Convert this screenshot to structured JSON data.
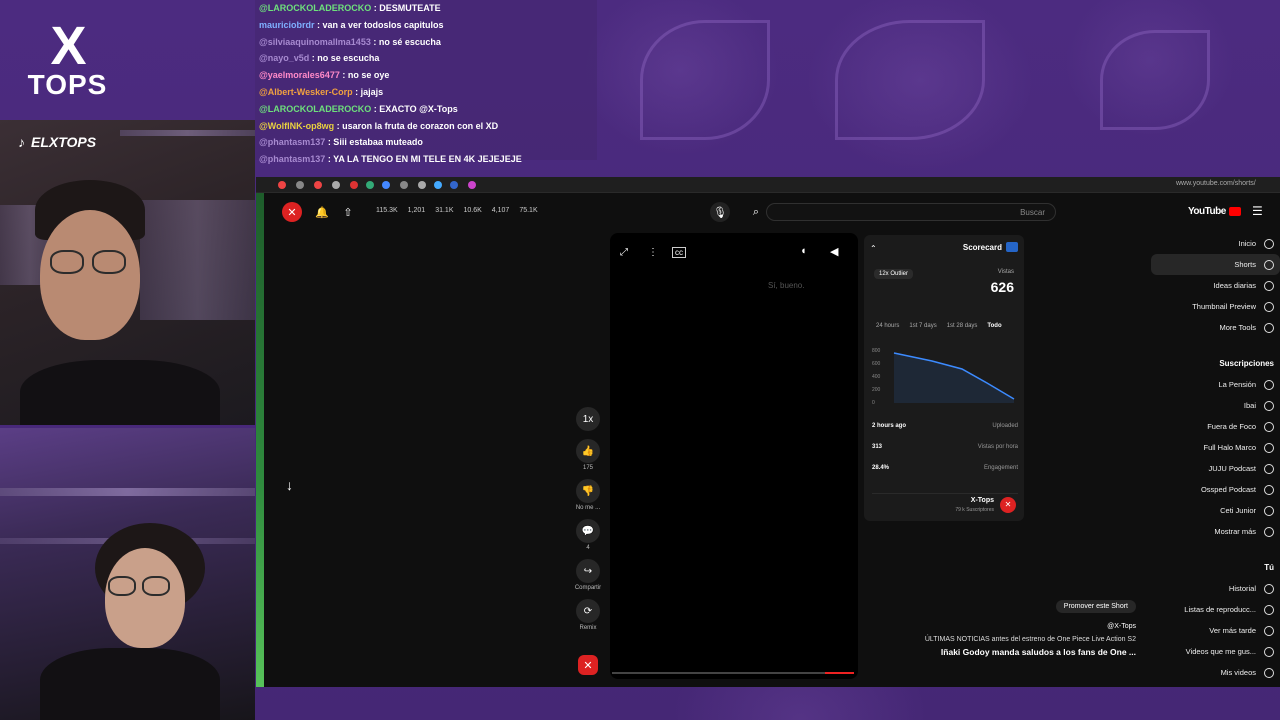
{
  "branding": {
    "logo_top": "X",
    "logo_bottom": "TOPS",
    "tiktok_handle": "ELXTOPS"
  },
  "chat": [
    {
      "user": "@LAROCKOLADEROCKO",
      "text": "DESMUTEATE",
      "color": "#6ee07c"
    },
    {
      "user": "mauriciobrdr",
      "text": "van a ver todoslos capitulos",
      "color": "#7fb0ff"
    },
    {
      "user": "@silviaaquinomallma1453",
      "text": "no sé escucha",
      "color": "#a78ad0"
    },
    {
      "user": "@nayo_v5d",
      "text": "no se escucha",
      "color": "#a78ad0"
    },
    {
      "user": "@yaelmorales6477",
      "text": "no se oye",
      "color": "#ff8ac8"
    },
    {
      "user": "@Albert-Wesker-Corp",
      "text": "jajajs",
      "color": "#f0a040"
    },
    {
      "user": "@LAROCKOLADEROCKO",
      "text": "EXACTO @X-Tops",
      "color": "#6ee07c"
    },
    {
      "user": "@WolfINK-op8wg",
      "text": "usaron la fruta de corazon con el XD",
      "color": "#e8d040"
    },
    {
      "user": "@phantasm137",
      "text": "Siii estabaa muteado",
      "color": "#a78ad0"
    },
    {
      "user": "@phantasm137",
      "text": "YA LA TENGO EN MI TELE EN 4K JEJEJEJE",
      "color": "#a78ad0"
    }
  ],
  "browser": {
    "url": "www.youtube.com/shorts/",
    "search_placeholder": "Buscar",
    "stats": [
      "115.3K",
      "1,201",
      "31.1K",
      "10.6K",
      "4,107",
      "75.1K"
    ]
  },
  "short": {
    "placeholder": "Sí, bueno.",
    "actions": [
      {
        "icon": "1x",
        "label": ""
      },
      {
        "icon": "👍",
        "label": "175"
      },
      {
        "icon": "👎",
        "label": "No me ..."
      },
      {
        "icon": "💬",
        "label": "4"
      },
      {
        "icon": "↪",
        "label": "Compartir"
      },
      {
        "icon": "⟳",
        "label": "Remix"
      }
    ],
    "progress": 0.12
  },
  "scorecard": {
    "title": "Scorecard",
    "badge": "12x Outlier",
    "views_label": "Vistas",
    "views": "626",
    "tabs": [
      "24 hours",
      "1st 7 days",
      "1st 28 days",
      "Todo"
    ],
    "y_ticks": [
      "800",
      "600",
      "400",
      "200",
      "0"
    ],
    "rows": [
      {
        "k": "Uploaded",
        "v": "2 hours ago"
      },
      {
        "k": "Vistas por hora",
        "v": "313"
      },
      {
        "k": "Engagement",
        "v": "28.4%"
      }
    ],
    "channel": "X-Tops",
    "subs": "79 k Suscriptores"
  },
  "yt_nav": {
    "top": [
      "Inicio",
      "Shorts",
      "Ideas diarias",
      "Thumbnail Preview",
      "More Tools"
    ],
    "subs_header": "Suscripciones",
    "subs": [
      "La Pensión",
      "Ibai",
      "Fuera de Foco",
      "Full Halo Marco",
      "JUJU Podcast",
      "Ossped Podcast",
      "Ceti Junior",
      "Mostrar más"
    ],
    "you_header": "Tú",
    "you": [
      "Historial",
      "Listas de reproducc...",
      "Ver más tarde",
      "Videos que me gus...",
      "Mis videos"
    ]
  },
  "video_info": {
    "promote": "Promover este Short",
    "channel": "@X-Tops",
    "line1": "ÚLTIMAS NOTICIAS antes del estreno de One Piece Live Action S2",
    "line2": "Iñaki Godoy manda saludos a los fans de One ..."
  }
}
